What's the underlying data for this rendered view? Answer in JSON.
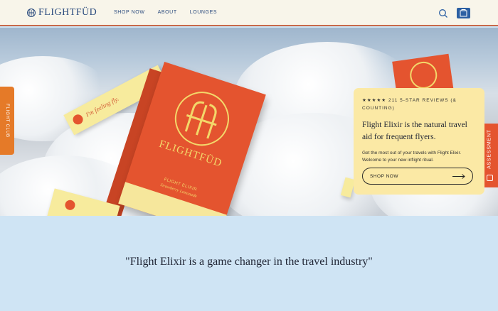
{
  "brand": {
    "name": "FLIGHTFÜD"
  },
  "nav": {
    "items": [
      "SHOP NOW",
      "ABOUT",
      "LOUNGES"
    ]
  },
  "colors": {
    "header_bg": "#f8f5ea",
    "brand_blue": "#2b4b7e",
    "accent_red": "#e4542f",
    "accent_orange": "#e57a28",
    "card_yellow": "#fbe9a5",
    "section_blue": "#cfe4f4"
  },
  "icons": {
    "search": "search-icon",
    "cart": "shopping-bag-icon",
    "arrow": "arrow-right-icon"
  },
  "side_tabs": {
    "left": "FLIGHT CLUB",
    "right": "ASSESSMENT"
  },
  "product": {
    "box_brand": "FLIGHTFÜD",
    "box_product": "FLIGHT ELIXIR",
    "box_flavor": "Strawberry Lemonade",
    "stick_text": "I'm feeling fly."
  },
  "promo": {
    "stars": "★★★★★",
    "reviews": "211 5-STAR REVIEWS (& COUNTING)",
    "headline": "Flight Elixir is the natural travel aid for frequent flyers.",
    "description": "Get the most out of your travels with Flight Elixir. Welcome to your new inflight ritual.",
    "cta": "SHOP NOW"
  },
  "testimonial": {
    "quote": "\"Flight Elixir is a game changer in the travel industry\""
  }
}
